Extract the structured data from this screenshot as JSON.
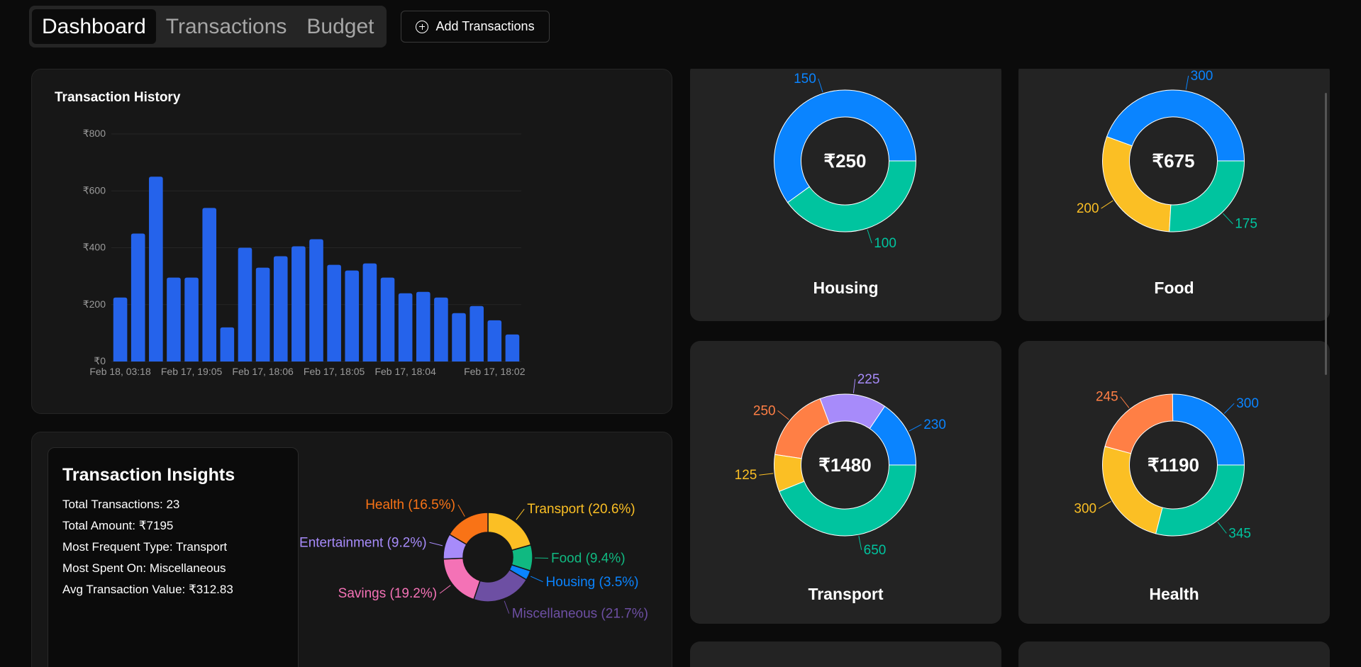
{
  "nav": {
    "tabs": [
      "Dashboard",
      "Transactions",
      "Budget"
    ],
    "active_tab": "Dashboard",
    "add_button": "Add Transactions"
  },
  "history": {
    "title": "Transaction History",
    "chart_data": {
      "type": "bar",
      "title": "Transaction History",
      "values": [
        225,
        450,
        650,
        295,
        295,
        540,
        120,
        400,
        330,
        370,
        405,
        430,
        340,
        320,
        345,
        295,
        240,
        245,
        225,
        170,
        195,
        145,
        95
      ],
      "x_tick_labels": [
        "Feb 18, 03:18",
        "Feb 17, 19:05",
        "Feb 17, 18:06",
        "Feb 17, 18:05",
        "Feb 17, 18:04",
        "Feb 17, 18:02"
      ],
      "y_tick_labels": [
        "₹0",
        "₹200",
        "₹400",
        "₹600",
        "₹800"
      ],
      "ylim": [
        0,
        800
      ],
      "color": "#2563eb"
    }
  },
  "insights": {
    "title": "Transaction Insights",
    "lines": [
      "Total Transactions: 23",
      "Total Amount: ₹7195",
      "Most Frequent Type: Transport",
      "Most Spent On: Miscellaneous",
      "Avg Transaction Value: ₹312.83"
    ],
    "chart_data": {
      "type": "pie",
      "slices": [
        {
          "label": "Transport (20.6%)",
          "value": 20.6,
          "color": "#fbbf24"
        },
        {
          "label": "Food (9.4%)",
          "value": 9.4,
          "color": "#10b981"
        },
        {
          "label": "Housing (3.5%)",
          "value": 3.5,
          "color": "#0a84ff"
        },
        {
          "label": "Miscellaneous (21.7%)",
          "value": 21.7,
          "color": "#6d4fa3"
        },
        {
          "label": "Savings (19.2%)",
          "value": 19.2,
          "color": "#f472b6"
        },
        {
          "label": "Entertainment (9.2%)",
          "value": 9.2,
          "color": "#a78bfa"
        },
        {
          "label": "Health (16.5%)",
          "value": 16.5,
          "color": "#f97316"
        }
      ]
    }
  },
  "categories": {
    "chart_data": [
      {
        "type": "pie",
        "name": "Housing",
        "total": "₹250",
        "slices": [
          {
            "value": 150,
            "label": "150",
            "color": "#0a84ff"
          },
          {
            "value": 100,
            "label": "100",
            "color": "#00c49f"
          }
        ]
      },
      {
        "type": "pie",
        "name": "Food",
        "total": "₹675",
        "slices": [
          {
            "value": 300,
            "label": "300",
            "color": "#0a84ff"
          },
          {
            "value": 200,
            "label": "200",
            "color": "#fbbf24"
          },
          {
            "value": 175,
            "label": "175",
            "color": "#00c49f"
          }
        ]
      },
      {
        "type": "pie",
        "name": "Transport",
        "total": "₹1480",
        "slices": [
          {
            "value": 230,
            "label": "230",
            "color": "#0a84ff"
          },
          {
            "value": 225,
            "label": "225",
            "color": "#a78bfa"
          },
          {
            "value": 250,
            "label": "250",
            "color": "#ff7f45"
          },
          {
            "value": 125,
            "label": "125",
            "color": "#fbbf24"
          },
          {
            "value": 650,
            "label": "650",
            "color": "#00c49f"
          }
        ]
      },
      {
        "type": "pie",
        "name": "Health",
        "total": "₹1190",
        "slices": [
          {
            "value": 300,
            "label": "300",
            "color": "#0a84ff"
          },
          {
            "value": 245,
            "label": "245",
            "color": "#ff7f45"
          },
          {
            "value": 300,
            "label": "300",
            "color": "#fbbf24"
          },
          {
            "value": 345,
            "label": "345",
            "color": "#00c49f"
          }
        ]
      }
    ]
  }
}
